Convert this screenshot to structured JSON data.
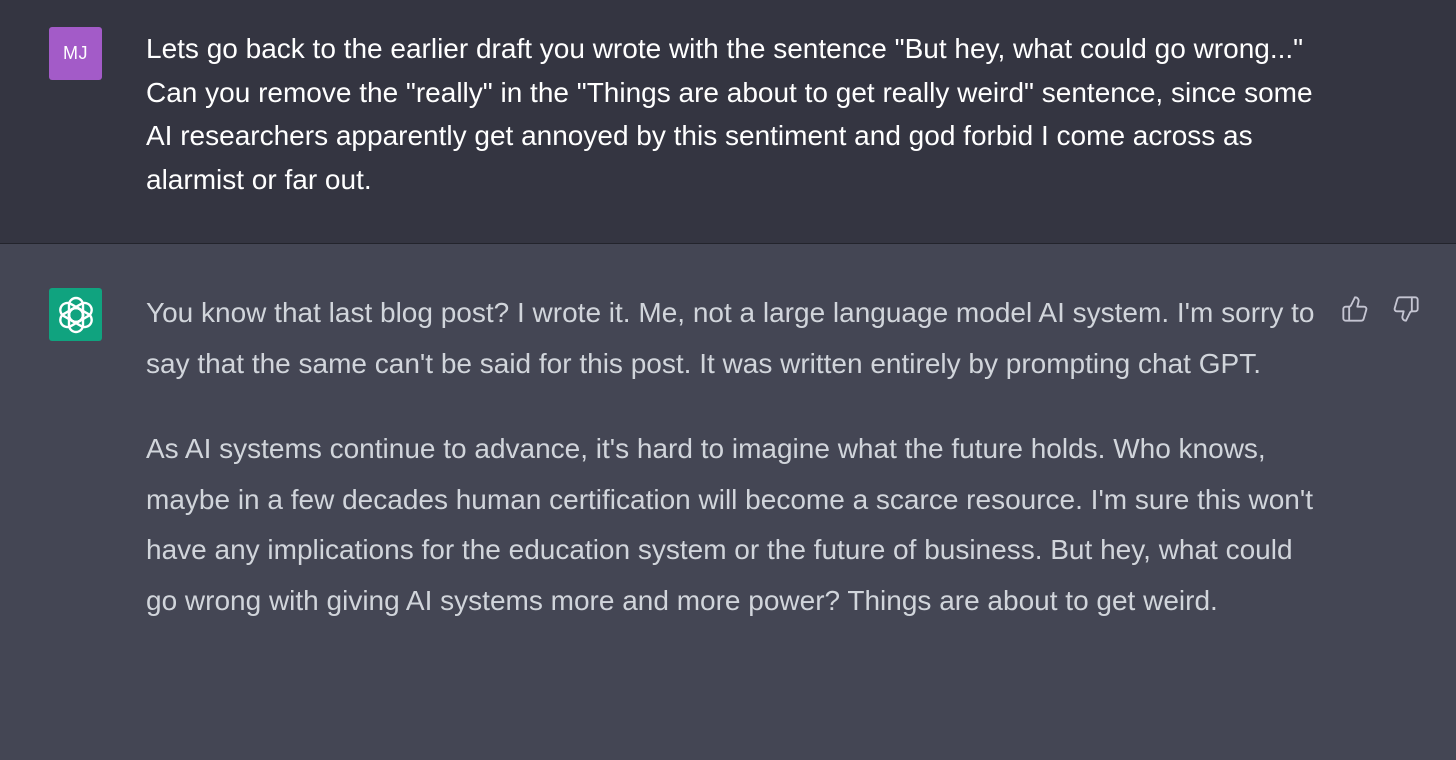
{
  "user_message": {
    "avatar_initials": "MJ",
    "avatar_color": "#a35bc8",
    "text": "Lets go back to the earlier draft you wrote with the sentence \"But hey, what could go wrong...\" Can you remove the \"really\" in the \"Things are about to get really weird\" sentence, since some AI researchers apparently get annoyed by this sentiment and god forbid I come across as alarmist or far out."
  },
  "assistant_message": {
    "avatar_icon": "openai-logo-icon",
    "avatar_color": "#10a37f",
    "paragraphs": [
      "You know that last blog post? I wrote it. Me, not a large language model AI system. I'm sorry to say that the same can't be said for this post. It was written entirely by prompting chat GPT.",
      "As AI systems continue to advance, it's hard to imagine what the future holds. Who knows, maybe in a few decades human certification will become a scarce resource. I'm sure this won't have any implications for the education system or the future of business. But hey, what could go wrong with giving AI systems more and more power? Things are about to get weird."
    ],
    "feedback_icons": [
      "thumbs-up-icon",
      "thumbs-down-icon"
    ]
  },
  "colors": {
    "user_background": "#343541",
    "assistant_background": "#444654",
    "user_text": "#ffffff",
    "assistant_text": "#d1d5db"
  }
}
